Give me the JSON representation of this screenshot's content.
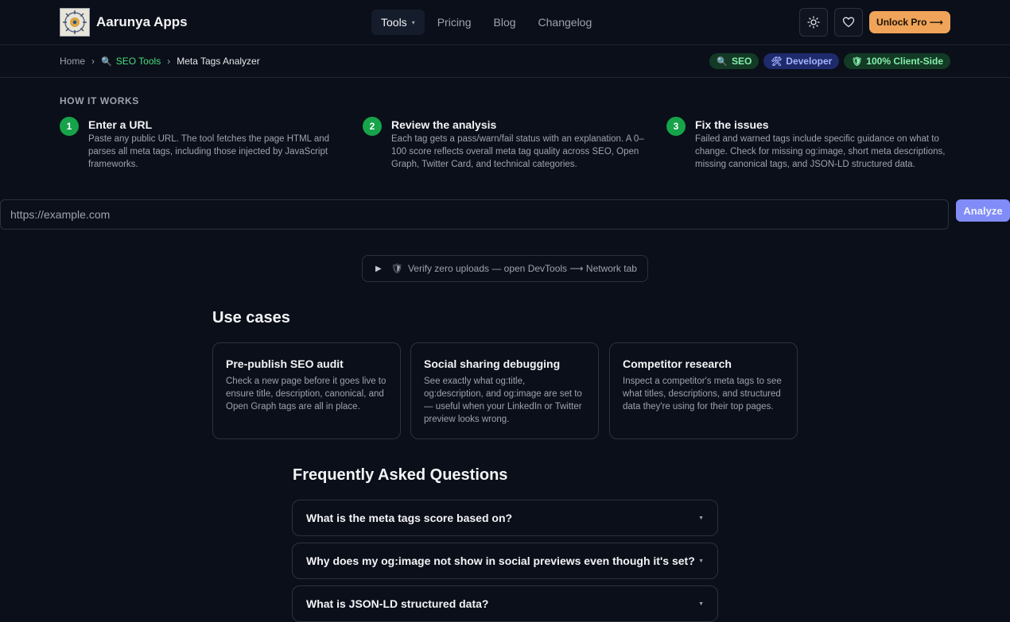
{
  "header": {
    "brand": "Aarunya Apps",
    "nav": [
      {
        "label": "Tools",
        "active": true,
        "has_caret": true
      },
      {
        "label": "Pricing"
      },
      {
        "label": "Blog"
      },
      {
        "label": "Changelog"
      }
    ],
    "caret_glyph": "▾",
    "theme_icon": "sun-icon",
    "favorite_icon": "heart-icon",
    "unlock_label": "Unlock Pro ⟶"
  },
  "breadcrumb": {
    "home": "Home",
    "sep": "›",
    "section": "SEO Tools",
    "section_icon": "🔍",
    "current": "Meta Tags Analyzer"
  },
  "badges": [
    {
      "icon": "🔍",
      "label": "SEO"
    },
    {
      "icon": "🛠",
      "label": "Developer"
    },
    {
      "icon": "🛡",
      "label": "100% Client-Side"
    }
  ],
  "how_it_works": {
    "title": "HOW IT WORKS",
    "steps": [
      {
        "num": "1",
        "title": "Enter a URL",
        "text": "Paste any public URL. The tool fetches the page HTML and parses all meta tags, including those injected by JavaScript frameworks."
      },
      {
        "num": "2",
        "title": "Review the analysis",
        "text": "Each tag gets a pass/warn/fail status with an explanation. A 0–100 score reflects overall meta tag quality across SEO, Open Graph, Twitter Card, and technical categories."
      },
      {
        "num": "3",
        "title": "Fix the issues",
        "text": "Failed and warned tags include specific guidance on what to change. Check for missing og:image, short meta descriptions, missing canonical tags, and JSON-LD structured data."
      }
    ]
  },
  "url_input": {
    "placeholder": "https://example.com",
    "value": ""
  },
  "analyze_label": "Analyze",
  "verify": {
    "icon": "🛡",
    "label": "Verify zero uploads — open DevTools ⟶ Network tab"
  },
  "use_cases": {
    "title": "Use cases",
    "cards": [
      {
        "title": "Pre-publish SEO audit",
        "text": "Check a new page before it goes live to ensure title, description, canonical, and Open Graph tags are all in place."
      },
      {
        "title": "Social sharing debugging",
        "text": "See exactly what og:title, og:description, and og:image are set to — useful when your LinkedIn or Twitter preview looks wrong."
      },
      {
        "title": "Competitor research",
        "text": "Inspect a competitor's meta tags to see what titles, descriptions, and structured data they're using for their top pages."
      }
    ]
  },
  "faq": {
    "title": "Frequently Asked Questions",
    "items": [
      {
        "q": "What is the meta tags score based on?"
      },
      {
        "q": "Why does my og:image not show in social previews even though it's set?"
      },
      {
        "q": "What is JSON-LD structured data?"
      }
    ],
    "caret": "▼"
  },
  "colors": {
    "background": "#0b0f19",
    "accent_green": "#16a34a",
    "unlock": "#f0a45a",
    "analyze": "#818cf8"
  }
}
